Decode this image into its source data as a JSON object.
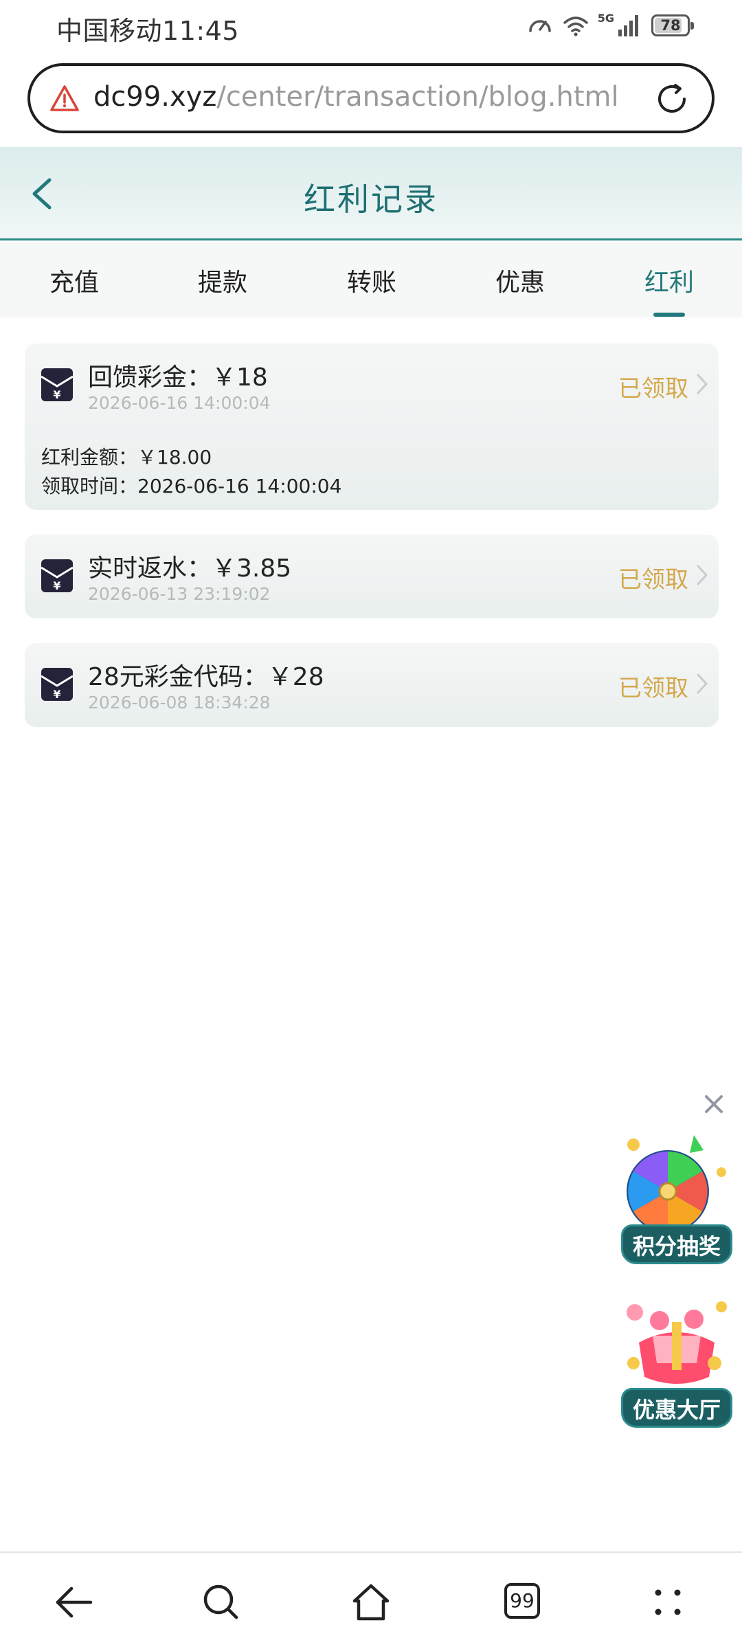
{
  "status_bar": {
    "carrier": "中国移动",
    "time": "11:45",
    "network": "5G",
    "battery": "78"
  },
  "browser": {
    "url_domain": "dc99.xyz",
    "url_path": "/center/transaction/blog.html",
    "tab_count": "99"
  },
  "header": {
    "title": "红利记录"
  },
  "tabs": [
    {
      "label": "充值"
    },
    {
      "label": "提款"
    },
    {
      "label": "转账"
    },
    {
      "label": "优惠"
    },
    {
      "label": "红利",
      "active": true
    }
  ],
  "records": [
    {
      "title": "回馈彩金：￥18",
      "time": "2026-06-16 14:00:04",
      "status": "已领取",
      "expanded": true,
      "details": [
        {
          "label": "红利金额：",
          "value": "￥18.00"
        },
        {
          "label": "领取时间：",
          "value": "2026-06-16 14:00:04"
        }
      ]
    },
    {
      "title": "实时返水：￥3.85",
      "time": "2026-06-13 23:19:02",
      "status": "已领取"
    },
    {
      "title": "28元彩金代码：￥28",
      "time": "2026-06-08 18:34:28",
      "status": "已领取"
    }
  ],
  "floating": {
    "promo1_label": "积分抽奖",
    "promo2_label": "优惠大厅"
  },
  "colors": {
    "accent": "#23787b",
    "status": "#d4a84c",
    "title": "#1f6f72"
  }
}
